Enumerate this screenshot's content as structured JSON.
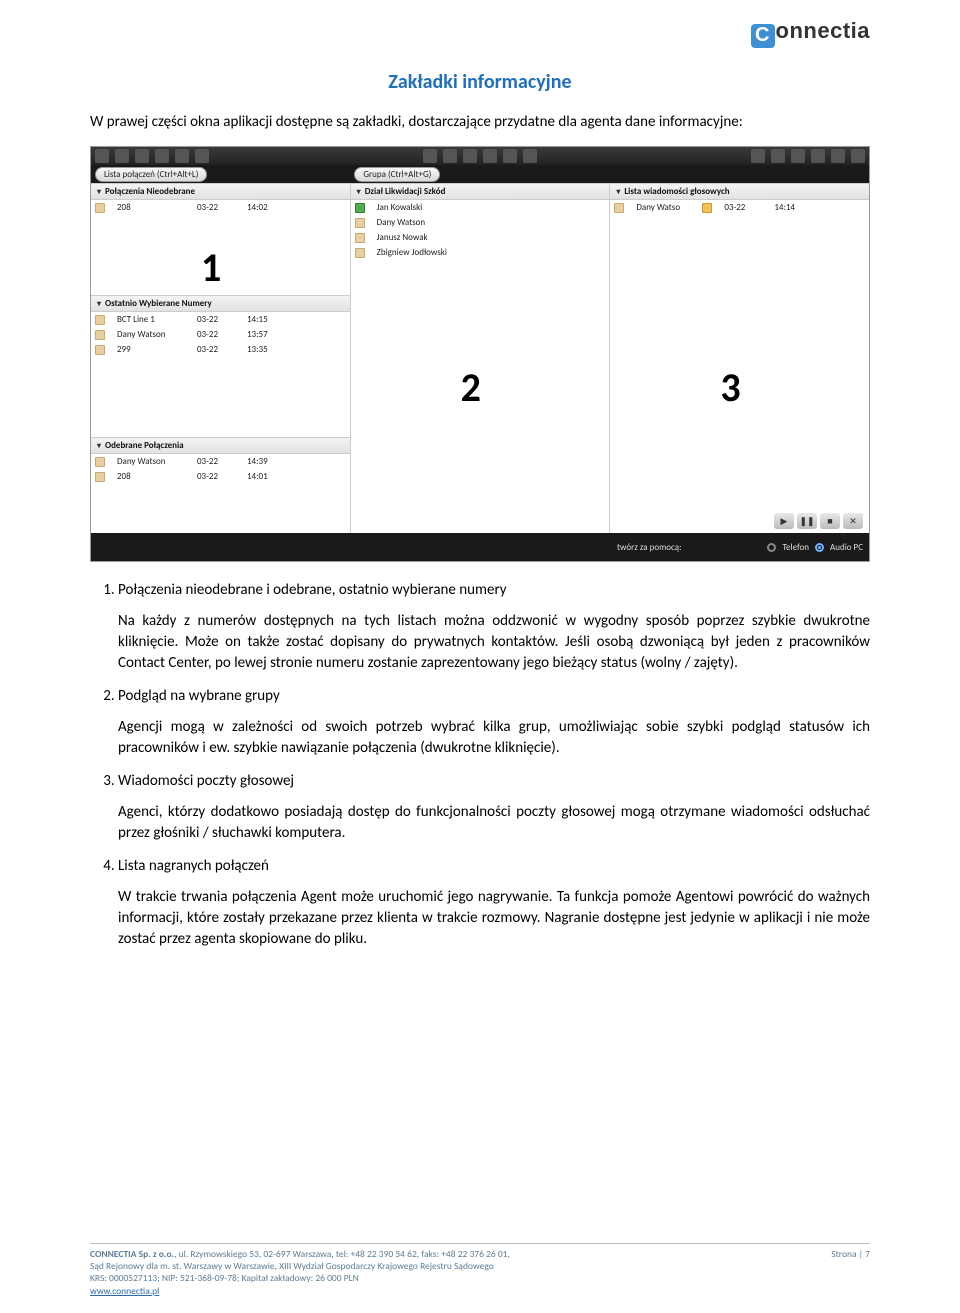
{
  "logo": {
    "c": "C",
    "rest": "onnectia"
  },
  "title": "Zakładki informacyjne",
  "intro": "W prawej części okna aplikacji dostępne są zakładki, dostarczające przydatne dla agenta dane informacyjne:",
  "screenshot": {
    "chip_left": "Lista połączeń (Ctrl+Alt+L)",
    "chip_mid": "Grupa (Ctrl+Alt+G)",
    "col1": {
      "num": "1",
      "sec1_title": "Połączenia Nieodebrane",
      "sec1_rows": [
        {
          "c1": "208",
          "c2": "03-22",
          "c3": "14:02"
        }
      ],
      "sec2_title": "Ostatnio Wybierane Numery",
      "sec2_rows": [
        {
          "c1": "BCT Line 1",
          "c2": "03-22",
          "c3": "14:15"
        },
        {
          "c1": "Dany Watson",
          "c2": "03-22",
          "c3": "13:57"
        },
        {
          "c1": "299",
          "c2": "03-22",
          "c3": "13:35"
        }
      ],
      "sec3_title": "Odebrane Połączenia",
      "sec3_rows": [
        {
          "c1": "Dany Watson",
          "c2": "03-22",
          "c3": "14:39"
        },
        {
          "c1": "208",
          "c2": "03-22",
          "c3": "14:01"
        }
      ]
    },
    "col2": {
      "num": "2",
      "sec1_title": "Dział Likwidacji Szkód",
      "sec1_rows": [
        {
          "c1": "Jan Kowalski"
        },
        {
          "c1": "Dany Watson"
        },
        {
          "c1": "Janusz Nowak"
        },
        {
          "c1": "Zbigniew Jodłowski"
        }
      ]
    },
    "col3": {
      "num": "3",
      "sec1_title": "Lista wiadomości głosowych",
      "sec1_rows": [
        {
          "c1": "Dany Watso",
          "c2": "03-22",
          "c3": "14:14"
        }
      ]
    },
    "footer_label": "twórz za pomocą:",
    "footer_opt1": "Telefon",
    "footer_opt2": "Audio PC"
  },
  "list": {
    "i1_title": "Połączenia nieodebrane i odebrane, ostatnio wybierane numery",
    "i1_body": "Na każdy z numerów dostępnych na tych listach można oddzwonić w wygodny sposób poprzez szybkie dwukrotne kliknięcie. Może on także zostać dopisany do prywatnych kontaktów. Jeśli osobą dzwoniącą był jeden z pracowników Contact Center, po lewej stronie numeru zostanie zaprezentowany jego bieżący status (wolny / zajęty).",
    "i2_title": "Podgląd na wybrane grupy",
    "i2_body": "Agencji mogą w zależności od swoich potrzeb wybrać kilka grup, umożliwiając sobie szybki podgląd statusów ich pracowników i ew. szybkie nawiązanie połączenia (dwukrotne kliknięcie).",
    "i3_title": "Wiadomości poczty głosowej",
    "i3_body": "Agenci, którzy dodatkowo posiadają dostęp do funkcjonalności poczty głosowej mogą otrzymane wiadomości odsłuchać przez głośniki / słuchawki komputera.",
    "i4_title": "Lista nagranych połączeń",
    "i4_body": "W trakcie trwania połączenia Agent może uruchomić jego nagrywanie. Ta funkcja pomoże Agentowi powrócić do ważnych informacji, które zostały przekazane przez klienta w trakcie rozmowy. Nagranie dostępne jest jedynie w aplikacji i nie może zostać przez agenta skopiowane do pliku."
  },
  "footer": {
    "line1a": "CONNECTIA Sp. z o.o.",
    "line1b": ", ul. Rzymowskiego 53, 02-697 Warszawa, tel: +48 22 390 54 62, faks: +48 22 376 26 01,",
    "line2": "Sąd Rejonowy dla m. st. Warszawy w Warszawie, XIII Wydział Gospodarczy Krajowego Rejestru Sądowego",
    "line3": "KRS: 0000527113; NIP: 521-368-09-78; Kapitał zakładowy: 26 000 PLN",
    "link": "www.connectia.pl",
    "page": "Strona | 7"
  }
}
